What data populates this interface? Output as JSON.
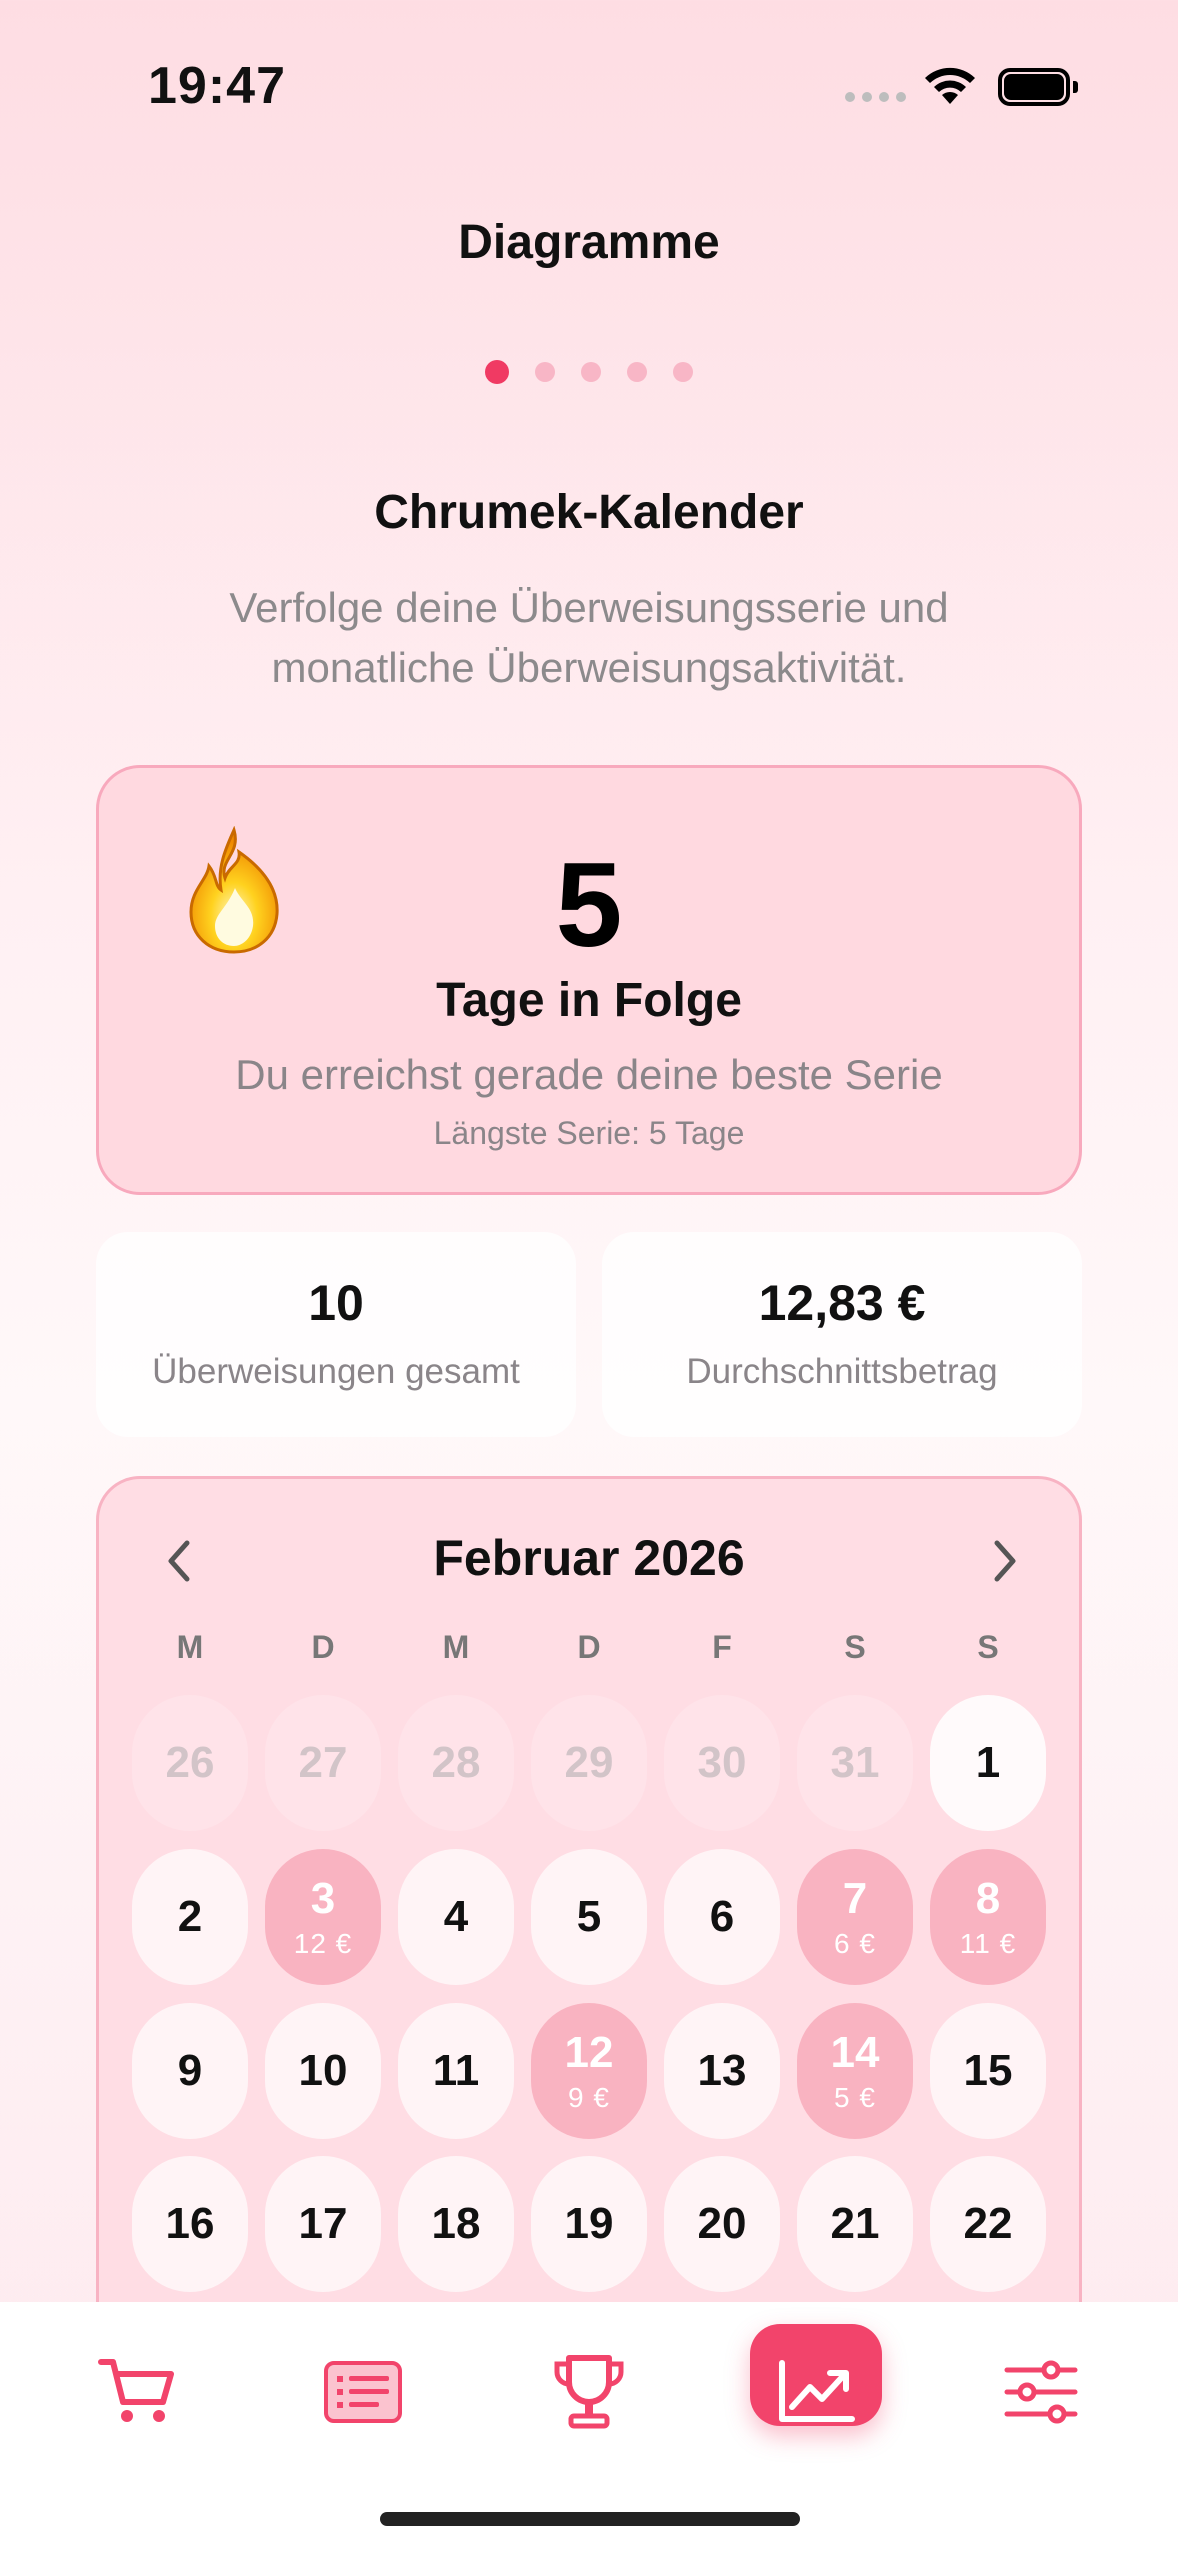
{
  "status_bar": {
    "time": "19:47"
  },
  "header": {
    "title": "Diagramme",
    "page_count": 5,
    "active_page": 0
  },
  "section": {
    "title": "Chrumek-Kalender",
    "subtitle": "Verfolge deine Überweisungsserie und monatliche Überweisungsaktivität."
  },
  "streak": {
    "icon": "flame-icon",
    "number": "5",
    "label": "Tage in Folge",
    "message": "Du erreichst gerade deine beste Serie",
    "longest": "Längste Serie: 5 Tage"
  },
  "stats": {
    "total_value": "10",
    "total_label": "Überweisungen gesamt",
    "avg_value": "12,83 €",
    "avg_label": "Durchschnittsbetrag"
  },
  "calendar": {
    "month": "Februar 2026",
    "weekdays": [
      "M",
      "D",
      "M",
      "D",
      "F",
      "S",
      "S"
    ],
    "days": [
      {
        "day": "26",
        "type": "out"
      },
      {
        "day": "27",
        "type": "out"
      },
      {
        "day": "28",
        "type": "out"
      },
      {
        "day": "29",
        "type": "out"
      },
      {
        "day": "30",
        "type": "out"
      },
      {
        "day": "31",
        "type": "out"
      },
      {
        "day": "1",
        "type": "white"
      },
      {
        "day": "2",
        "type": "normal"
      },
      {
        "day": "3",
        "type": "active",
        "amount": "12 €"
      },
      {
        "day": "4",
        "type": "normal"
      },
      {
        "day": "5",
        "type": "normal"
      },
      {
        "day": "6",
        "type": "normal"
      },
      {
        "day": "7",
        "type": "active",
        "amount": "6 €"
      },
      {
        "day": "8",
        "type": "active",
        "amount": "11 €"
      },
      {
        "day": "9",
        "type": "normal"
      },
      {
        "day": "10",
        "type": "normal"
      },
      {
        "day": "11",
        "type": "normal"
      },
      {
        "day": "12",
        "type": "active",
        "amount": "9 €"
      },
      {
        "day": "13",
        "type": "normal"
      },
      {
        "day": "14",
        "type": "active",
        "amount": "5 €"
      },
      {
        "day": "15",
        "type": "normal"
      },
      {
        "day": "16",
        "type": "normal"
      },
      {
        "day": "17",
        "type": "normal"
      },
      {
        "day": "18",
        "type": "normal"
      },
      {
        "day": "19",
        "type": "normal"
      },
      {
        "day": "20",
        "type": "normal"
      },
      {
        "day": "21",
        "type": "normal"
      },
      {
        "day": "22",
        "type": "normal"
      }
    ]
  },
  "tab_bar": {
    "tabs": [
      "cart-icon",
      "list-icon",
      "trophy-icon",
      "chart-icon",
      "sliders-icon"
    ],
    "active_tab": "chart-icon"
  },
  "colors": {
    "accent": "#f2446b",
    "active_day": "#f9b3c1",
    "card_bg": "#ffd9e0"
  }
}
